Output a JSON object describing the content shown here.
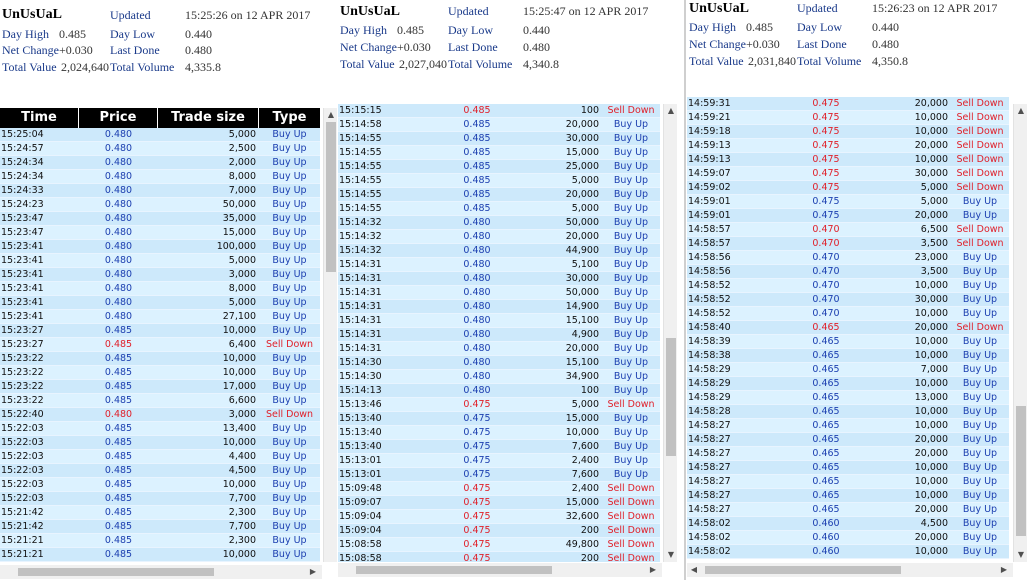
{
  "panels": [
    {
      "header": {
        "name": "UnUsUaL",
        "day_high_label": "Day High",
        "day_high": "0.485",
        "net_change_label": "Net Change",
        "net_change": "+0.030",
        "total_value_label": "Total Value",
        "total_value": "2,024,640",
        "updated_label": "Updated",
        "updated": "15:25:26 on 12 APR 2017",
        "day_low_label": "Day Low",
        "day_low": "0.440",
        "last_done_label": "Last Done",
        "last_done": "0.480",
        "total_volume_label": "Total Volume",
        "total_volume": "4,335.8"
      },
      "columns": {
        "time": "Time",
        "price": "Price",
        "size": "Trade size",
        "type": "Type"
      },
      "rows": [
        [
          "15:25:04",
          "0.480",
          "5,000",
          "Buy Up"
        ],
        [
          "15:24:57",
          "0.480",
          "2,500",
          "Buy Up"
        ],
        [
          "15:24:34",
          "0.480",
          "2,000",
          "Buy Up"
        ],
        [
          "15:24:34",
          "0.480",
          "8,000",
          "Buy Up"
        ],
        [
          "15:24:33",
          "0.480",
          "7,000",
          "Buy Up"
        ],
        [
          "15:24:23",
          "0.480",
          "50,000",
          "Buy Up"
        ],
        [
          "15:23:47",
          "0.480",
          "35,000",
          "Buy Up"
        ],
        [
          "15:23:47",
          "0.480",
          "15,000",
          "Buy Up"
        ],
        [
          "15:23:41",
          "0.480",
          "100,000",
          "Buy Up"
        ],
        [
          "15:23:41",
          "0.480",
          "5,000",
          "Buy Up"
        ],
        [
          "15:23:41",
          "0.480",
          "3,000",
          "Buy Up"
        ],
        [
          "15:23:41",
          "0.480",
          "8,000",
          "Buy Up"
        ],
        [
          "15:23:41",
          "0.480",
          "5,000",
          "Buy Up"
        ],
        [
          "15:23:41",
          "0.480",
          "27,100",
          "Buy Up"
        ],
        [
          "15:23:27",
          "0.485",
          "10,000",
          "Buy Up"
        ],
        [
          "15:23:27",
          "0.485",
          "6,400",
          "Sell Down"
        ],
        [
          "15:23:22",
          "0.485",
          "10,000",
          "Buy Up"
        ],
        [
          "15:23:22",
          "0.485",
          "10,000",
          "Buy Up"
        ],
        [
          "15:23:22",
          "0.485",
          "17,000",
          "Buy Up"
        ],
        [
          "15:23:22",
          "0.485",
          "6,600",
          "Buy Up"
        ],
        [
          "15:22:40",
          "0.480",
          "3,000",
          "Sell Down"
        ],
        [
          "15:22:03",
          "0.485",
          "13,400",
          "Buy Up"
        ],
        [
          "15:22:03",
          "0.485",
          "10,000",
          "Buy Up"
        ],
        [
          "15:22:03",
          "0.485",
          "4,400",
          "Buy Up"
        ],
        [
          "15:22:03",
          "0.485",
          "4,500",
          "Buy Up"
        ],
        [
          "15:22:03",
          "0.485",
          "10,000",
          "Buy Up"
        ],
        [
          "15:22:03",
          "0.485",
          "7,700",
          "Buy Up"
        ],
        [
          "15:21:42",
          "0.485",
          "2,300",
          "Buy Up"
        ],
        [
          "15:21:42",
          "0.485",
          "7,700",
          "Buy Up"
        ],
        [
          "15:21:21",
          "0.485",
          "2,300",
          "Buy Up"
        ],
        [
          "15:21:21",
          "0.485",
          "10,000",
          "Buy Up"
        ]
      ]
    },
    {
      "header": {
        "name": "UnUsUaL",
        "day_high_label": "Day High",
        "day_high": "0.485",
        "net_change_label": "Net Change",
        "net_change": "+0.030",
        "total_value_label": "Total Value",
        "total_value": "2,027,040",
        "updated_label": "Updated",
        "updated": "15:25:47 on 12 APR 2017",
        "day_low_label": "Day Low",
        "day_low": "0.440",
        "last_done_label": "Last Done",
        "last_done": "0.480",
        "total_volume_label": "Total Volume",
        "total_volume": "4,340.8"
      },
      "rows": [
        [
          "15:15:15",
          "0.485",
          "100",
          "Sell Down"
        ],
        [
          "15:14:58",
          "0.485",
          "20,000",
          "Buy Up"
        ],
        [
          "15:14:55",
          "0.485",
          "30,000",
          "Buy Up"
        ],
        [
          "15:14:55",
          "0.485",
          "15,000",
          "Buy Up"
        ],
        [
          "15:14:55",
          "0.485",
          "25,000",
          "Buy Up"
        ],
        [
          "15:14:55",
          "0.485",
          "5,000",
          "Buy Up"
        ],
        [
          "15:14:55",
          "0.485",
          "20,000",
          "Buy Up"
        ],
        [
          "15:14:55",
          "0.485",
          "5,000",
          "Buy Up"
        ],
        [
          "15:14:32",
          "0.480",
          "50,000",
          "Buy Up"
        ],
        [
          "15:14:32",
          "0.480",
          "20,000",
          "Buy Up"
        ],
        [
          "15:14:32",
          "0.480",
          "44,900",
          "Buy Up"
        ],
        [
          "15:14:31",
          "0.480",
          "5,100",
          "Buy Up"
        ],
        [
          "15:14:31",
          "0.480",
          "30,000",
          "Buy Up"
        ],
        [
          "15:14:31",
          "0.480",
          "50,000",
          "Buy Up"
        ],
        [
          "15:14:31",
          "0.480",
          "14,900",
          "Buy Up"
        ],
        [
          "15:14:31",
          "0.480",
          "15,100",
          "Buy Up"
        ],
        [
          "15:14:31",
          "0.480",
          "4,900",
          "Buy Up"
        ],
        [
          "15:14:31",
          "0.480",
          "20,000",
          "Buy Up"
        ],
        [
          "15:14:30",
          "0.480",
          "15,100",
          "Buy Up"
        ],
        [
          "15:14:30",
          "0.480",
          "34,900",
          "Buy Up"
        ],
        [
          "15:14:13",
          "0.480",
          "100",
          "Buy Up"
        ],
        [
          "15:13:46",
          "0.475",
          "5,000",
          "Sell Down"
        ],
        [
          "15:13:40",
          "0.475",
          "15,000",
          "Buy Up"
        ],
        [
          "15:13:40",
          "0.475",
          "10,000",
          "Buy Up"
        ],
        [
          "15:13:40",
          "0.475",
          "7,600",
          "Buy Up"
        ],
        [
          "15:13:01",
          "0.475",
          "2,400",
          "Buy Up"
        ],
        [
          "15:13:01",
          "0.475",
          "7,600",
          "Buy Up"
        ],
        [
          "15:09:48",
          "0.475",
          "2,400",
          "Sell Down"
        ],
        [
          "15:09:07",
          "0.475",
          "15,000",
          "Sell Down"
        ],
        [
          "15:09:04",
          "0.475",
          "32,600",
          "Sell Down"
        ],
        [
          "15:09:04",
          "0.475",
          "200",
          "Sell Down"
        ],
        [
          "15:08:58",
          "0.475",
          "49,800",
          "Sell Down"
        ],
        [
          "15:08:58",
          "0.475",
          "200",
          "Sell Down"
        ]
      ]
    },
    {
      "header": {
        "name": "UnUsUaL",
        "day_high_label": "Day High",
        "day_high": "0.485",
        "net_change_label": "Net Change",
        "net_change": "+0.030",
        "total_value_label": "Total Value",
        "total_value": "2,031,840",
        "updated_label": "Updated",
        "updated": "15:26:23 on 12 APR 2017",
        "day_low_label": "Day Low",
        "day_low": "0.440",
        "last_done_label": "Last Done",
        "last_done": "0.480",
        "total_volume_label": "Total Volume",
        "total_volume": "4,350.8"
      },
      "rows": [
        [
          "14:59:31",
          "0.475",
          "20,000",
          "Sell Down"
        ],
        [
          "14:59:21",
          "0.475",
          "10,000",
          "Sell Down"
        ],
        [
          "14:59:18",
          "0.475",
          "10,000",
          "Sell Down"
        ],
        [
          "14:59:13",
          "0.475",
          "20,000",
          "Sell Down"
        ],
        [
          "14:59:13",
          "0.475",
          "10,000",
          "Sell Down"
        ],
        [
          "14:59:07",
          "0.475",
          "30,000",
          "Sell Down"
        ],
        [
          "14:59:02",
          "0.475",
          "5,000",
          "Sell Down"
        ],
        [
          "14:59:01",
          "0.475",
          "5,000",
          "Buy Up"
        ],
        [
          "14:59:01",
          "0.475",
          "20,000",
          "Buy Up"
        ],
        [
          "14:58:57",
          "0.470",
          "6,500",
          "Sell Down"
        ],
        [
          "14:58:57",
          "0.470",
          "3,500",
          "Sell Down"
        ],
        [
          "14:58:56",
          "0.470",
          "23,000",
          "Buy Up"
        ],
        [
          "14:58:56",
          "0.470",
          "3,500",
          "Buy Up"
        ],
        [
          "14:58:52",
          "0.470",
          "10,000",
          "Buy Up"
        ],
        [
          "14:58:52",
          "0.470",
          "30,000",
          "Buy Up"
        ],
        [
          "14:58:52",
          "0.470",
          "10,000",
          "Buy Up"
        ],
        [
          "14:58:40",
          "0.465",
          "20,000",
          "Sell Down"
        ],
        [
          "14:58:39",
          "0.465",
          "10,000",
          "Buy Up"
        ],
        [
          "14:58:38",
          "0.465",
          "10,000",
          "Buy Up"
        ],
        [
          "14:58:29",
          "0.465",
          "7,000",
          "Buy Up"
        ],
        [
          "14:58:29",
          "0.465",
          "10,000",
          "Buy Up"
        ],
        [
          "14:58:29",
          "0.465",
          "13,000",
          "Buy Up"
        ],
        [
          "14:58:28",
          "0.465",
          "10,000",
          "Buy Up"
        ],
        [
          "14:58:27",
          "0.465",
          "10,000",
          "Buy Up"
        ],
        [
          "14:58:27",
          "0.465",
          "20,000",
          "Buy Up"
        ],
        [
          "14:58:27",
          "0.465",
          "20,000",
          "Buy Up"
        ],
        [
          "14:58:27",
          "0.465",
          "10,000",
          "Buy Up"
        ],
        [
          "14:58:27",
          "0.465",
          "10,000",
          "Buy Up"
        ],
        [
          "14:58:27",
          "0.465",
          "10,000",
          "Buy Up"
        ],
        [
          "14:58:27",
          "0.465",
          "20,000",
          "Buy Up"
        ],
        [
          "14:58:02",
          "0.460",
          "4,500",
          "Buy Up"
        ],
        [
          "14:58:02",
          "0.460",
          "20,000",
          "Buy Up"
        ],
        [
          "14:58:02",
          "0.460",
          "10,000",
          "Buy Up"
        ]
      ]
    }
  ],
  "scroll_arrows": {
    "up": "▲",
    "down": "▼",
    "left": "◀",
    "right": "▶"
  }
}
